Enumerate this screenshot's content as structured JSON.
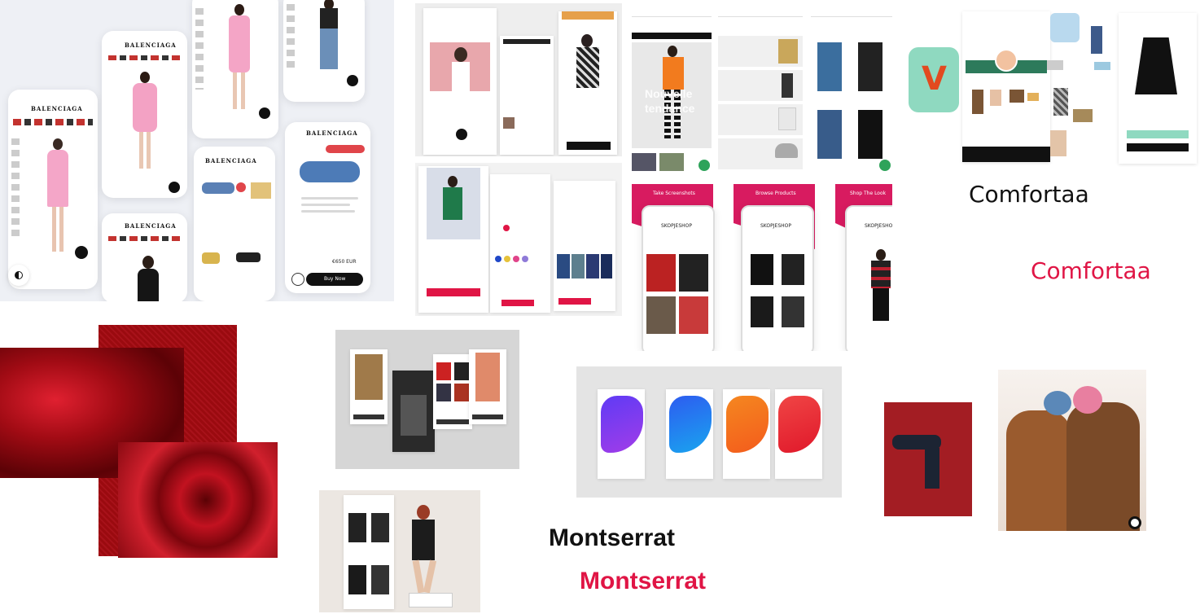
{
  "font_samples": {
    "comfortaa_dark": "Comfortaa",
    "comfortaa_red": "Comfortaa",
    "montserrat_dark": "Montserrat",
    "montserrat_red": "Montserrat"
  },
  "balenciaga": {
    "brand": "BALENCIAGA",
    "price": "€650 EUR",
    "cta": "Buy Now"
  },
  "skopjeshop": {
    "brand": "SKOPJESHOP",
    "headers": [
      "Take Screenshots",
      "Browse Products",
      "Shop The Look"
    ]
  },
  "nouvelle": {
    "hero_text": "Nouvelle tendance"
  },
  "colors": {
    "accent_red": "#e01545",
    "dark_text": "#111111",
    "velvet": "#9a0a0f",
    "pink_header": "#d81b60",
    "mint": "#8fd9c0"
  },
  "icons": [
    "contrast-icon",
    "arrow-right-icon",
    "heart-icon",
    "bag-icon",
    "menu-icon",
    "search-icon"
  ]
}
